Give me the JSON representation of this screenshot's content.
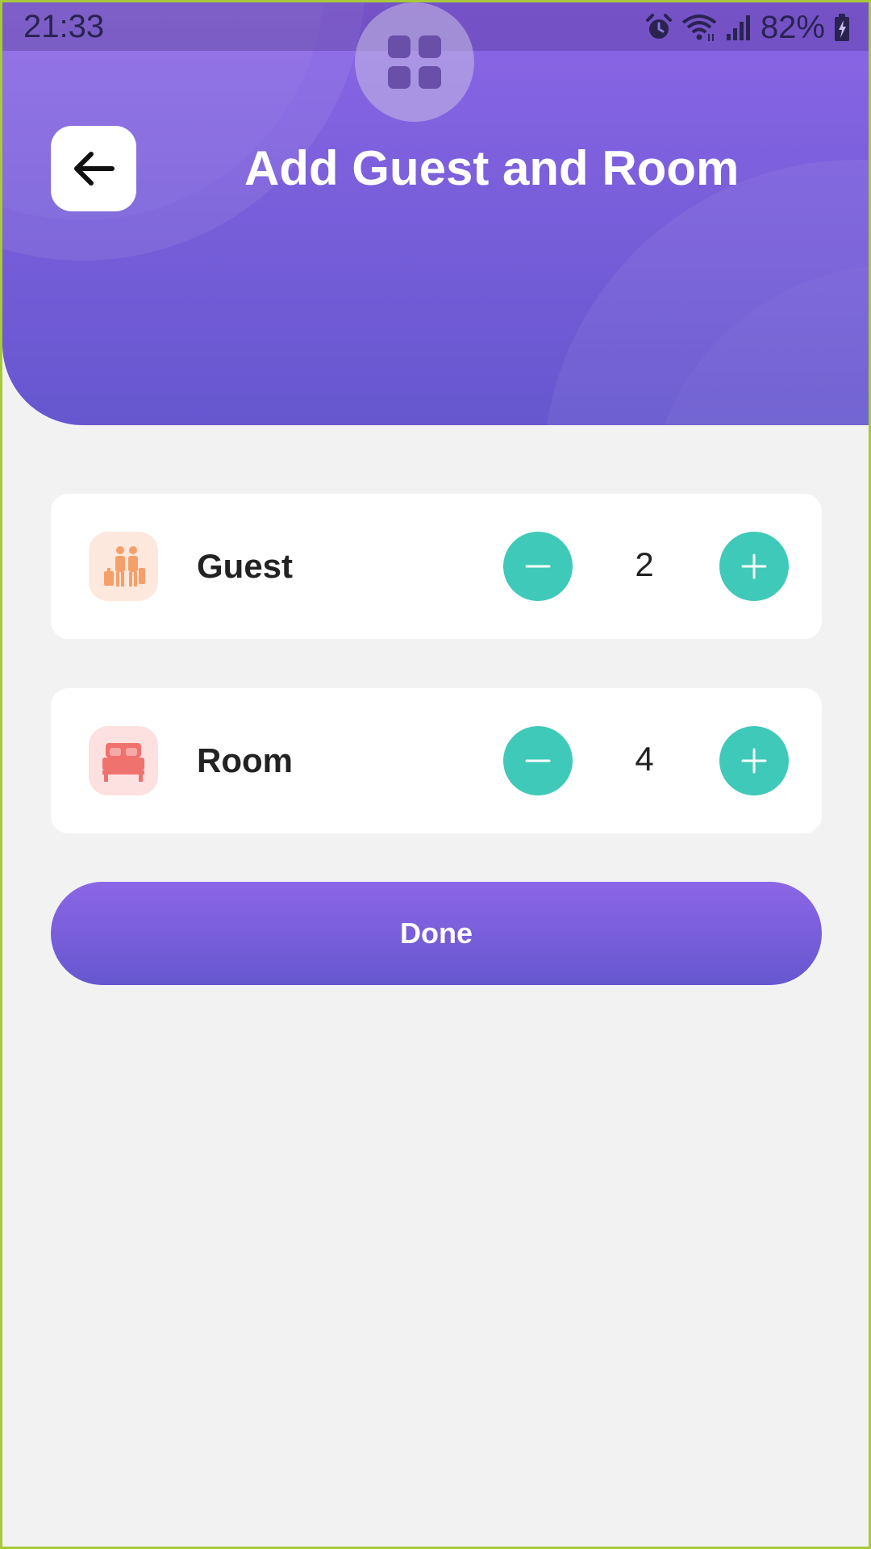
{
  "status_bar": {
    "time": "21:33",
    "battery_percent": "82%",
    "icons": [
      "alarm-icon",
      "wifi-icon",
      "signal-icon",
      "battery-charging-icon"
    ]
  },
  "header": {
    "title": "Add Guest and Room",
    "back_icon": "arrow-left-icon"
  },
  "counters": [
    {
      "label": "Guest",
      "value": "2",
      "icon": "guests-luggage-icon",
      "icon_color": "#f5a06a",
      "icon_bg": "#fde8dd"
    },
    {
      "label": "Room",
      "value": "4",
      "icon": "bed-icon",
      "icon_color": "#f0726f",
      "icon_bg": "#fde0e0"
    }
  ],
  "actions": {
    "done_label": "Done"
  },
  "colors": {
    "accent_purple": "#7a5fdb",
    "stepper_teal": "#3fc9b9",
    "background": "#f2f2f3"
  }
}
